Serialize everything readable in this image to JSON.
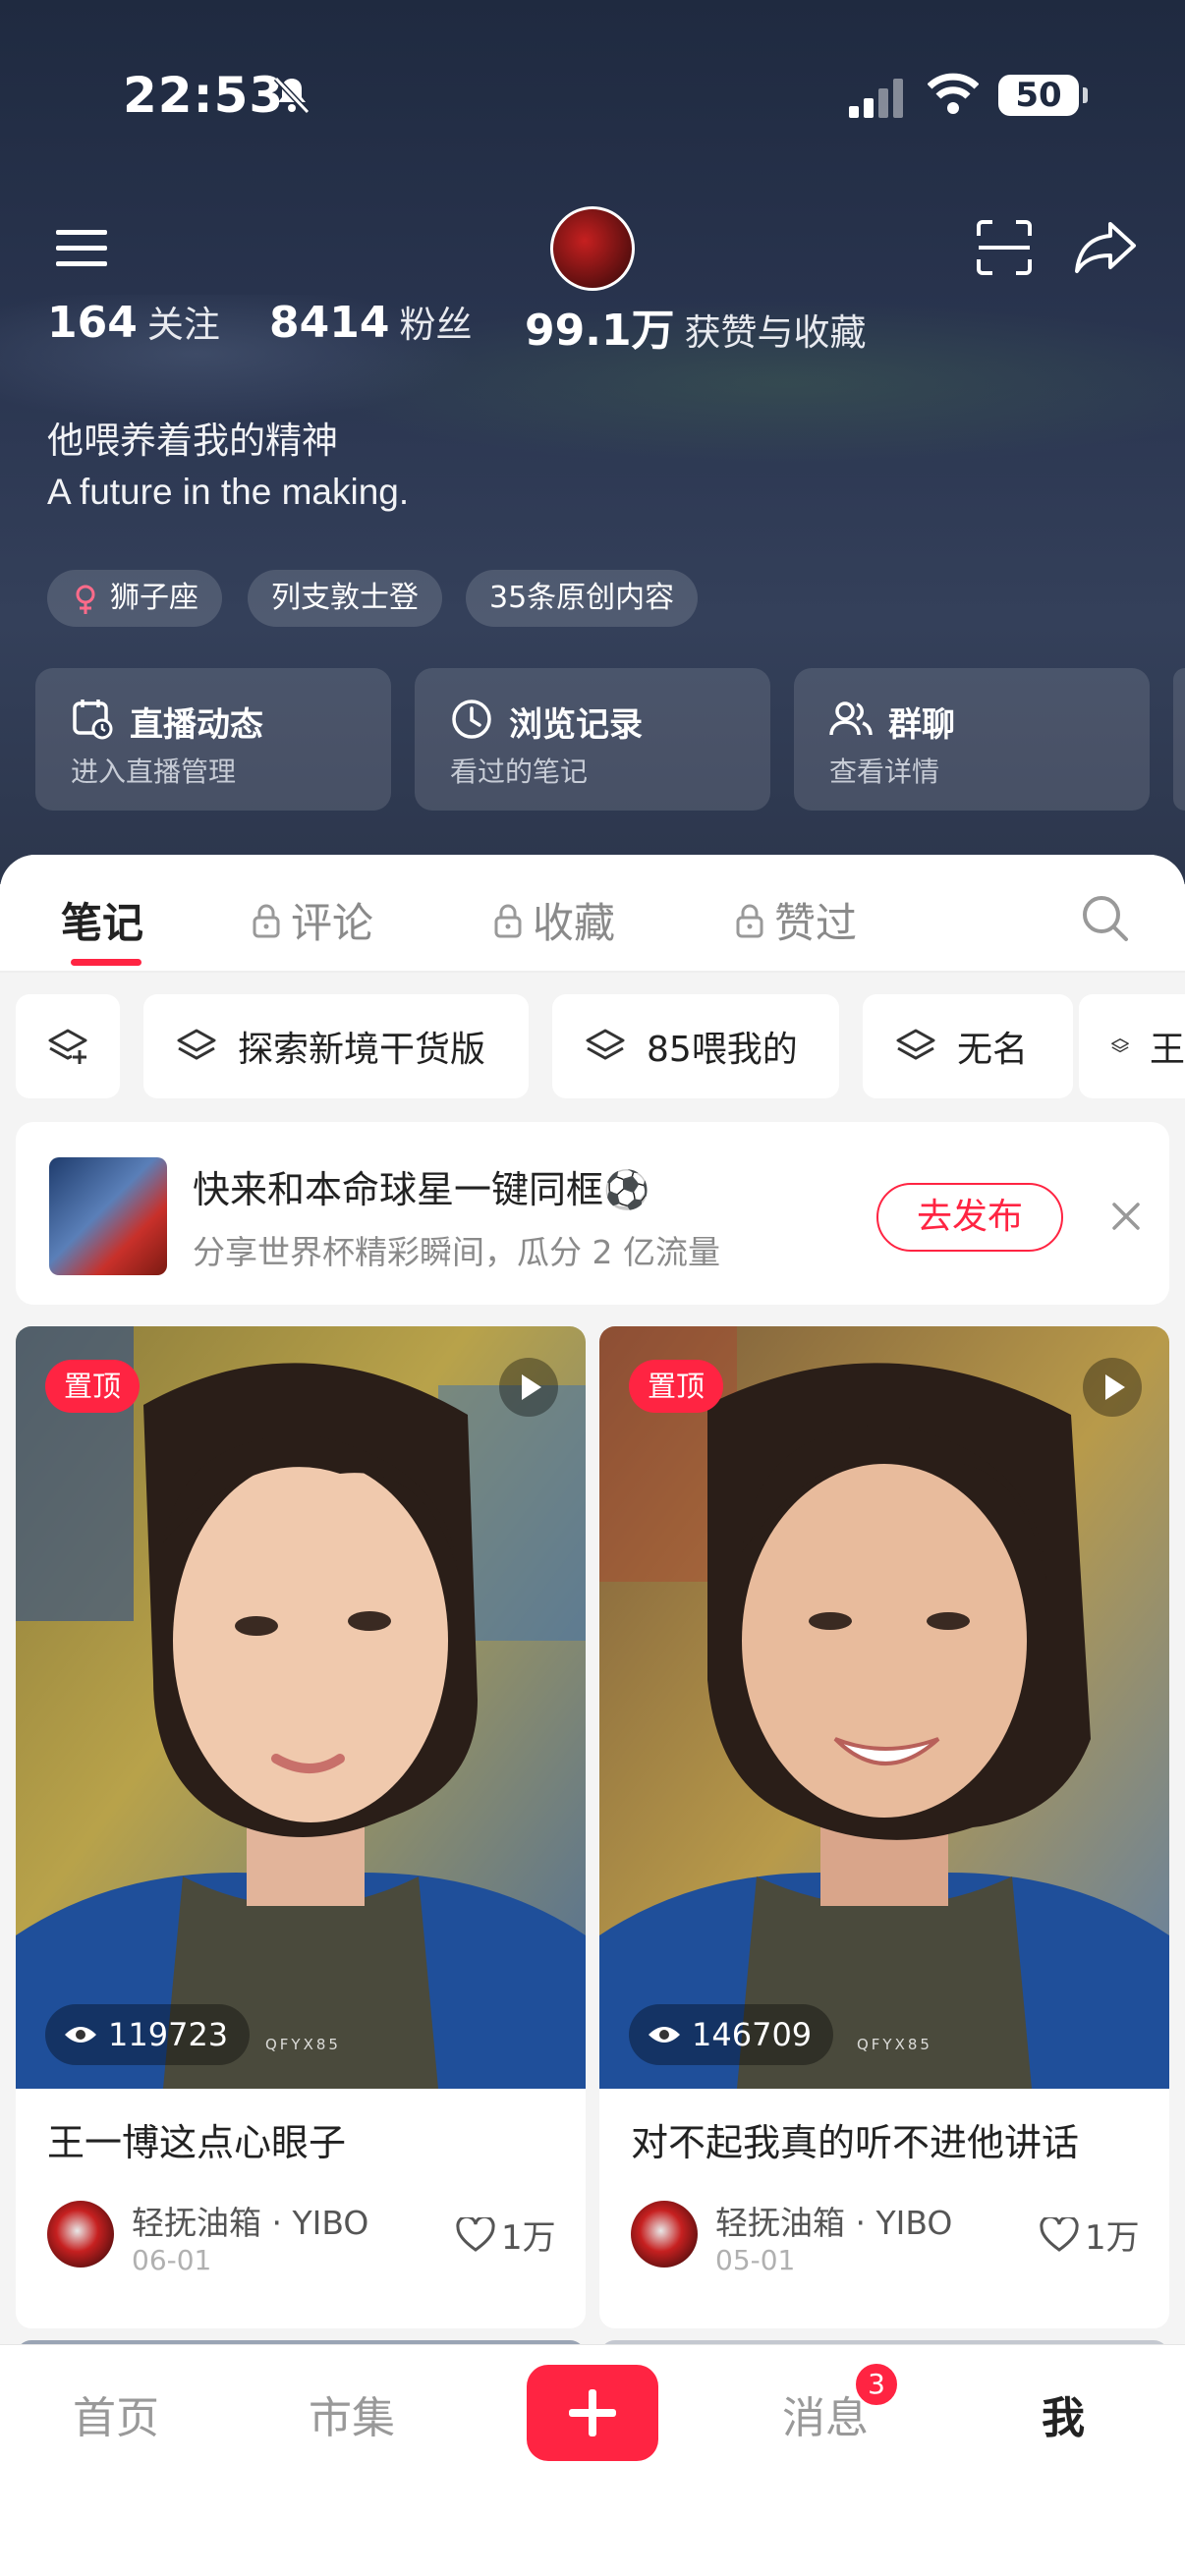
{
  "status_bar": {
    "time": "22:53",
    "battery": "50"
  },
  "profile": {
    "stats": [
      {
        "num": "164",
        "label": "关注"
      },
      {
        "num": "8414",
        "label": "粉丝"
      },
      {
        "num": "99.1万",
        "label": "获赞与收藏"
      }
    ],
    "bio_line1": "他喂养着我的精神",
    "bio_line2": "A future in the making.",
    "tags": [
      "狮子座",
      "列支敦士登",
      "35条原创内容"
    ],
    "cards": [
      {
        "title": "直播动态",
        "sub": "进入直播管理"
      },
      {
        "title": "浏览记录",
        "sub": "看过的笔记"
      },
      {
        "title": "群聊",
        "sub": "查看详情"
      }
    ]
  },
  "tabs": [
    "笔记",
    "评论",
    "收藏",
    "赞过"
  ],
  "chips": [
    "探索新境干货版",
    "85喂我的",
    "无名",
    "王"
  ],
  "promo": {
    "title": "快来和本命球星一键同框⚽",
    "sub": "分享世界杯精彩瞬间，瓜分 2 亿流量",
    "button": "去发布"
  },
  "notes": [
    {
      "pin": "置顶",
      "views": "119723",
      "watermark": "QFYX85",
      "title": "王一博这点心眼子",
      "author": "轻抚油箱 · YIBO",
      "date": "06-01",
      "likes": "1万"
    },
    {
      "pin": "置顶",
      "views": "146709",
      "watermark": "QFYX85",
      "title": "对不起我真的听不进他讲话",
      "author": "轻抚油箱 · YIBO",
      "date": "05-01",
      "likes": "1万"
    }
  ],
  "bottom_nav": {
    "home": "首页",
    "market": "市集",
    "messages": "消息",
    "me": "我",
    "badge": "3"
  },
  "colors": {
    "accent": "#ff2442",
    "header_bg": "#2a3550"
  }
}
